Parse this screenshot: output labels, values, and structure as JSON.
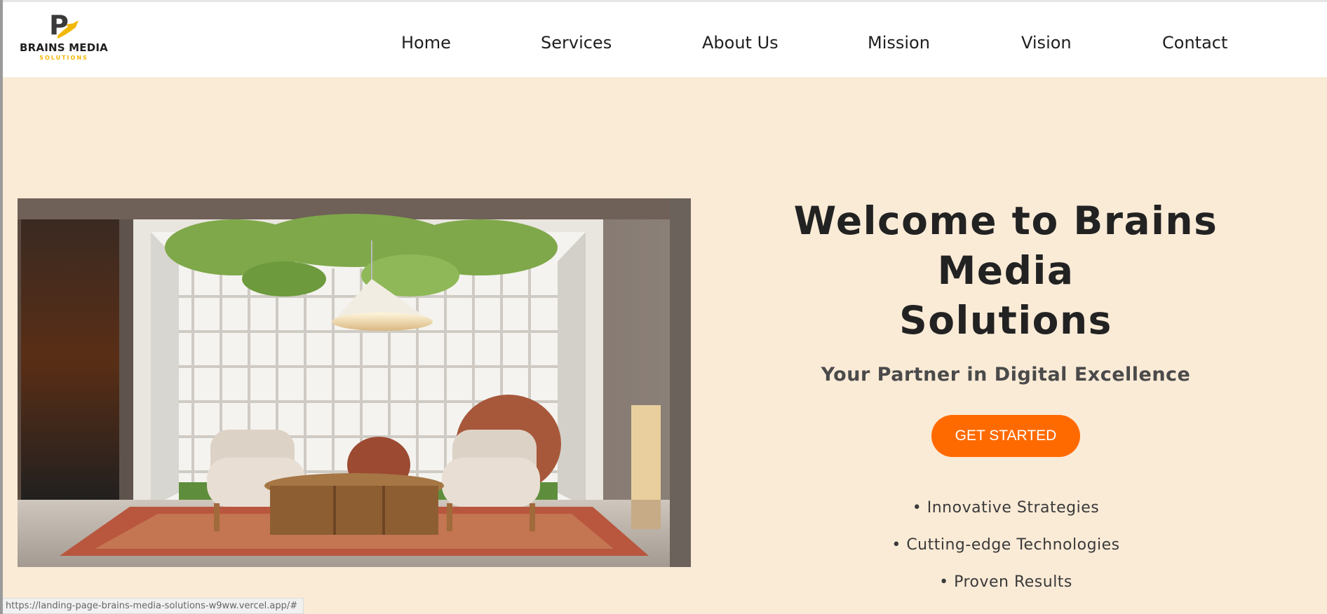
{
  "brand": {
    "logo_letter": "P",
    "name": "BRAINS MEDIA",
    "tagline": "SOLUTIONS"
  },
  "nav": {
    "items": [
      {
        "label": "Home"
      },
      {
        "label": "Services"
      },
      {
        "label": "About Us"
      },
      {
        "label": "Mission"
      },
      {
        "label": "Vision"
      },
      {
        "label": "Contact"
      }
    ]
  },
  "hero": {
    "title_line1": "Welcome to Brains Media",
    "title_line2": "Solutions",
    "subtitle": "Your Partner in Digital Excellence",
    "cta_label": "GET STARTED",
    "features": [
      "• Innovative Strategies",
      "• Cutting-edge Technologies",
      "• Proven Results"
    ]
  },
  "status_bar": {
    "url": "https://landing-page-brains-media-solutions-w9ww.vercel.app/#"
  },
  "colors": {
    "background": "#faebd7",
    "accent": "#ff6a00",
    "logo_yellow": "#f2b705",
    "text_dark": "#222222"
  }
}
